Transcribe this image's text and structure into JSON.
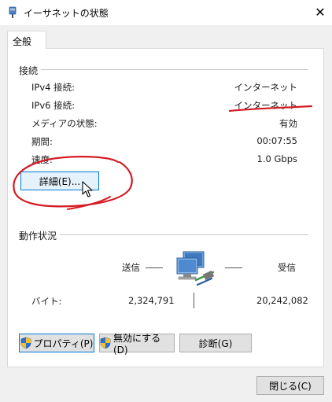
{
  "window": {
    "title": "イーサネットの状態",
    "close_glyph": "✕"
  },
  "tabs": [
    {
      "label": "全般",
      "selected": true
    }
  ],
  "connection": {
    "section_label": "接続",
    "rows": [
      {
        "label": "IPv4 接続:",
        "value": "インターネット"
      },
      {
        "label": "IPv6 接続:",
        "value": "インターネット"
      },
      {
        "label": "メディアの状態:",
        "value": "有効"
      },
      {
        "label": "期間:",
        "value": "00:07:55"
      },
      {
        "label": "速度:",
        "value": "1.0 Gbps"
      }
    ],
    "details_button": "詳細(E)..."
  },
  "activity": {
    "section_label": "動作状況",
    "sent_label": "送信",
    "received_label": "受信",
    "bytes_label": "バイト:",
    "bytes_sent": "2,324,791",
    "bytes_received": "20,242,082"
  },
  "buttons": {
    "properties": "プロパティ(P)",
    "disable": "無効にする(D)",
    "diagnose": "診断(G)",
    "close": "閉じる(C)"
  },
  "colors": {
    "annotation_red": "#d41c24",
    "accent_blue": "#0078d7",
    "panel_border": "#d9d9d9"
  },
  "icons": {
    "title": "ethernet-plug-icon",
    "network": "network-computers-icon",
    "shield": "uac-shield-icon",
    "cursor": "mouse-pointer-icon"
  }
}
